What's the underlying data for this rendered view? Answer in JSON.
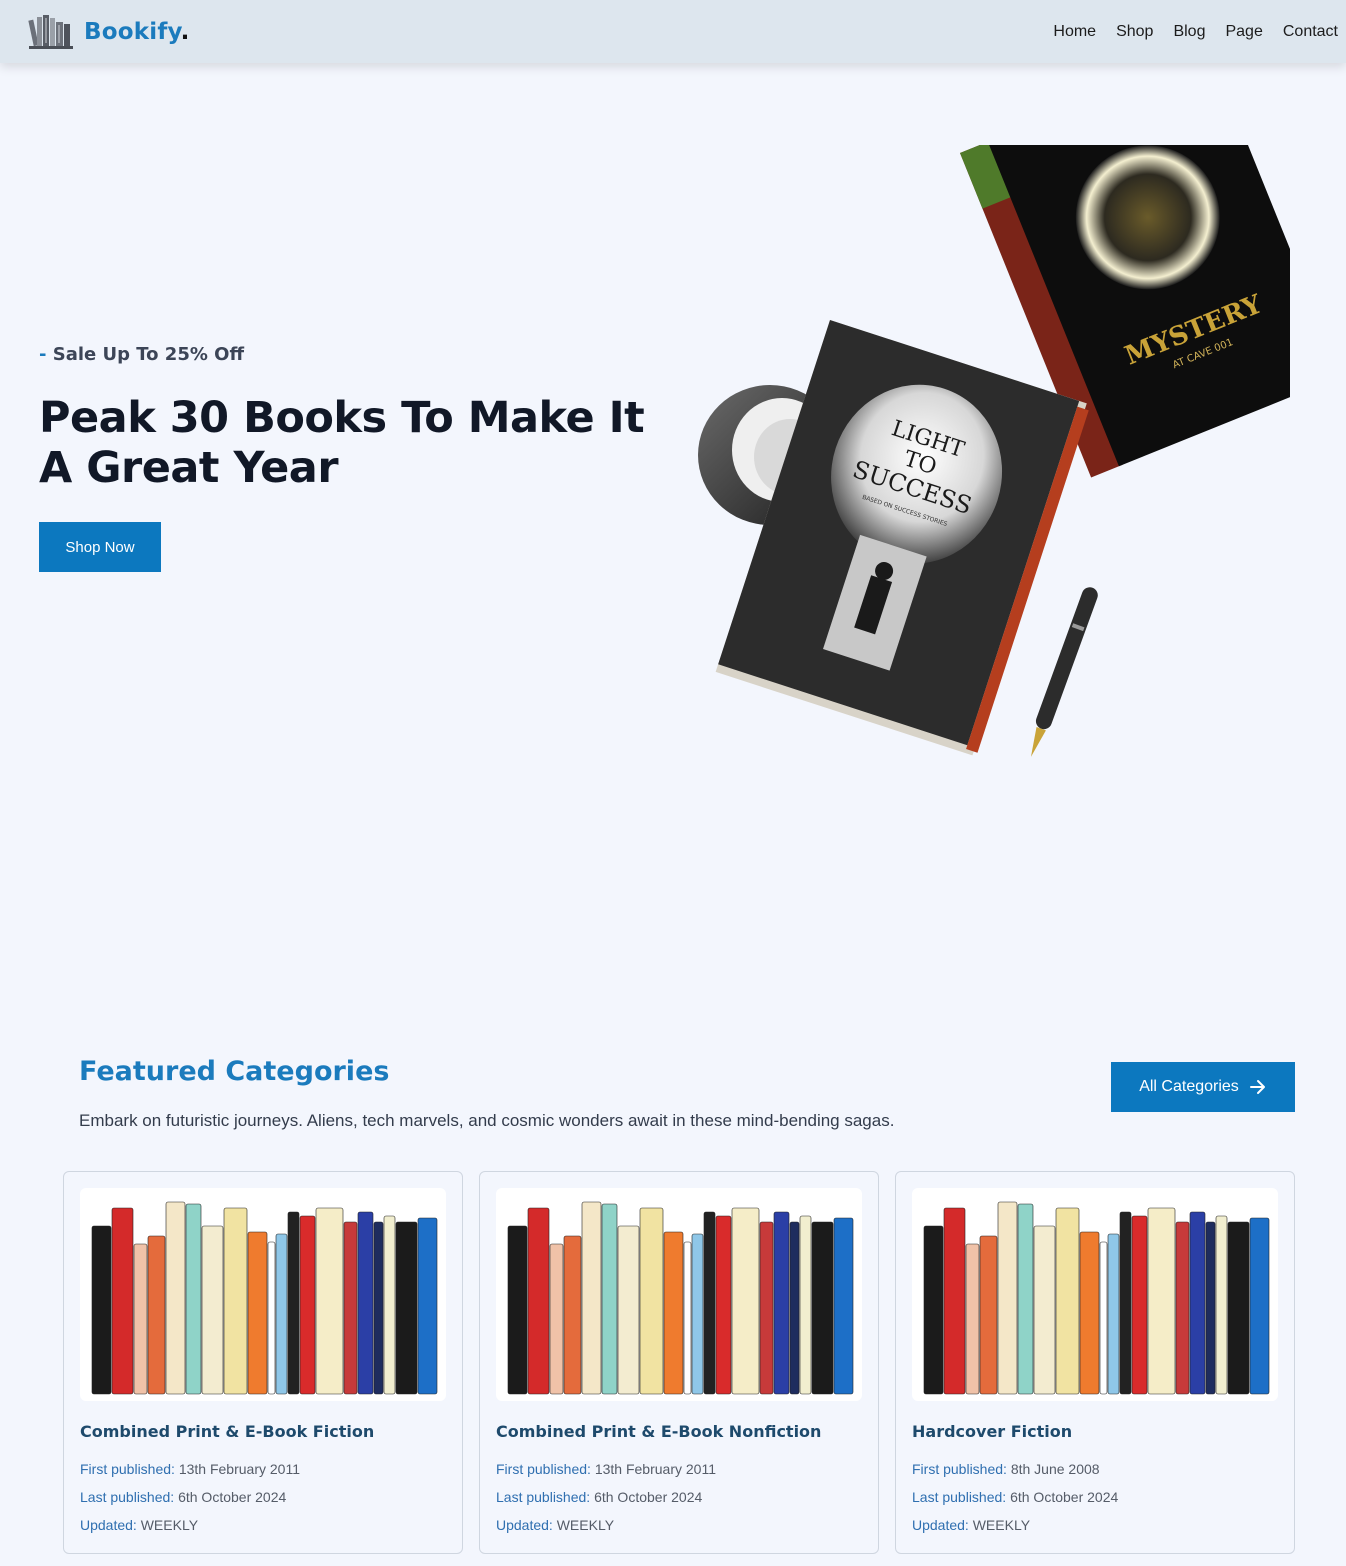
{
  "nav": {
    "brand": "Bookify",
    "brand_dot": ".",
    "links": [
      "Home",
      "Shop",
      "Blog",
      "Page",
      "Contact"
    ]
  },
  "hero": {
    "tagline_dash": "-",
    "tagline": "Sale Up To 25% Off",
    "title": "Peak 30 Books To Make It A Great Year",
    "button": "Shop Now",
    "art": {
      "book1_title_lines": [
        "LIGHT",
        "TO",
        "SUCCESS"
      ],
      "book1_subtitle": "BASED ON SUCCESS STORIES",
      "book2_title": "MYSTERY",
      "book2_subtitle": "AT CAVE 001"
    }
  },
  "featured": {
    "title": "Featured Categories",
    "description": "Embark on futuristic journeys. Aliens, tech marvels, and cosmic wonders await in these mind-bending sagas.",
    "button": "All Categories",
    "cards": [
      {
        "title": "Combined Print & E-Book Fiction",
        "first_label": "First published:",
        "first": "13th February 2011",
        "last_label": "Last published:",
        "last": "6th October 2024",
        "updated_label": "Updated:",
        "updated": "WEEKLY"
      },
      {
        "title": "Combined Print & E-Book Nonfiction",
        "first_label": "First published:",
        "first": "13th February 2011",
        "last_label": "Last published:",
        "last": "6th October 2024",
        "updated_label": "Updated:",
        "updated": "WEEKLY"
      },
      {
        "title": "Hardcover Fiction",
        "first_label": "First published:",
        "first": "8th June 2008",
        "last_label": "Last published:",
        "last": "6th October 2024",
        "updated_label": "Updated:",
        "updated": "WEEKLY"
      }
    ]
  },
  "colors": {
    "accent": "#1b7bbd",
    "button": "#0c78bf",
    "page_bg": "#f3f6fd",
    "nav_bg": "#dde6ee",
    "heading": "#111827",
    "card_title": "#1e4a6c"
  },
  "icons": {
    "logo": "bookshelf-logo-icon",
    "arrow": "arrow-right-icon"
  },
  "shelf_books": [
    {
      "color": "#1b1b1b"
    },
    {
      "color": "#d42a2a"
    },
    {
      "color": "#f0c2a8"
    },
    {
      "color": "#e46b3c"
    },
    {
      "color": "#f4e7c8"
    },
    {
      "color": "#8fd3c8"
    },
    {
      "color": "#f3ecd0"
    },
    {
      "color": "#f1e3a2"
    },
    {
      "color": "#ef7b2e"
    },
    {
      "color": "#ffffff"
    },
    {
      "color": "#8fc7e8"
    },
    {
      "color": "#222222"
    },
    {
      "color": "#d92b2b"
    },
    {
      "color": "#f5edc8"
    },
    {
      "color": "#c73a3a"
    },
    {
      "color": "#2b3fa6"
    },
    {
      "color": "#1e2c5e"
    },
    {
      "color": "#f1eecf"
    },
    {
      "color": "#1b1b1b"
    },
    {
      "color": "#1d6fc7"
    }
  ]
}
